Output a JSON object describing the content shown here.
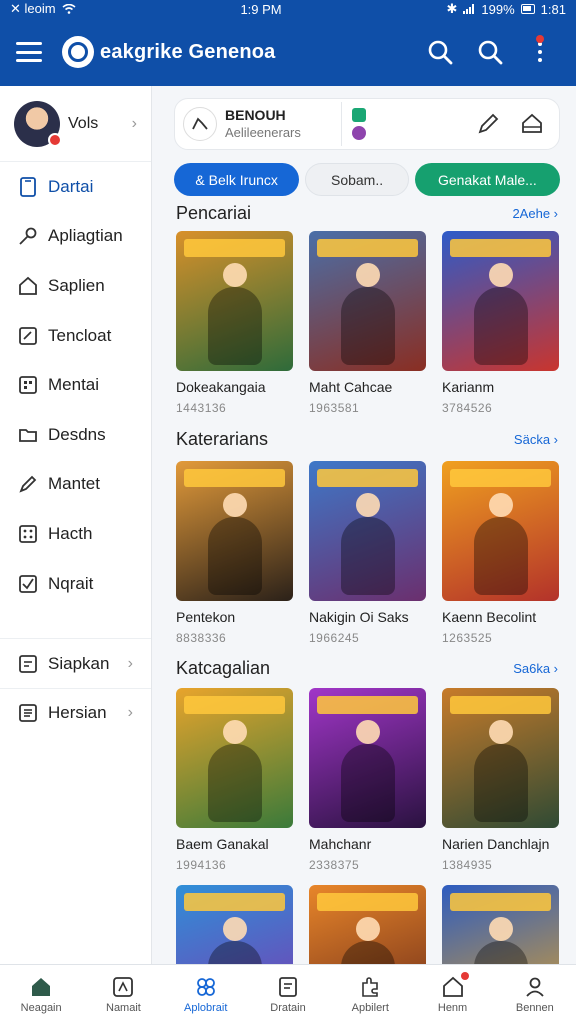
{
  "status_bar": {
    "carrier": "✕ leoim",
    "time": "1:9 PM",
    "battery": "199%",
    "clock2": "1:81"
  },
  "app_bar": {
    "title": "eakgrike Genenoa"
  },
  "sidebar": {
    "profile_name": "Vols",
    "items": [
      {
        "label": "Dartai",
        "icon": "phone-icon"
      },
      {
        "label": "Apliagtian",
        "icon": "key-icon"
      },
      {
        "label": "Saplien",
        "icon": "home-icon"
      },
      {
        "label": "Tencloat",
        "icon": "edit-box-icon"
      },
      {
        "label": "Mentai",
        "icon": "grid-icon"
      },
      {
        "label": "Desdns",
        "icon": "folder-icon"
      },
      {
        "label": "Mantet",
        "icon": "pen-icon"
      },
      {
        "label": "Hacth",
        "icon": "grid-small-icon"
      },
      {
        "label": "Nqrait",
        "icon": "check-icon"
      }
    ],
    "extra_items": [
      {
        "label": "Siapkan",
        "icon": "note-icon"
      },
      {
        "label": "Hersian",
        "icon": "list-icon"
      }
    ]
  },
  "top_card": {
    "title": "BENOUH",
    "subtitle": "Aelileenerars"
  },
  "chips": [
    "& Belk Iruncx",
    "Sobam..",
    "Genakat Male..."
  ],
  "sections": [
    {
      "title": "Pencariai",
      "more": "2Aehe ›",
      "games": [
        {
          "name": "Dokeakangaia",
          "stat": "1443136",
          "c1": "#d8902a",
          "c2": "#2e6b3a"
        },
        {
          "name": "Maht Cahcae",
          "stat": "1963581",
          "c1": "#4a6fa8",
          "c2": "#8a2e22"
        },
        {
          "name": "Karianm",
          "stat": "3784526",
          "c1": "#2d5bc9",
          "c2": "#c9352e"
        }
      ]
    },
    {
      "title": "Katerarians",
      "more": "Säcka ›",
      "games": [
        {
          "name": "Pentekon",
          "stat": "8838336",
          "c1": "#e29a3a",
          "c2": "#2b2119"
        },
        {
          "name": "Nakigin Oi Saks",
          "stat": "1966245",
          "c1": "#3e78c8",
          "c2": "#6b2f6e"
        },
        {
          "name": "Kaenn Becolint",
          "stat": "1263525",
          "c1": "#f0a020",
          "c2": "#b3322a"
        }
      ]
    },
    {
      "title": "Katcagalian",
      "more": "Sa6ka ›",
      "games": [
        {
          "name": "Baem Ganakal",
          "stat": "1994136",
          "c1": "#e8a42c",
          "c2": "#3a7a3a"
        },
        {
          "name": "Mahchanr",
          "stat": "2338375",
          "c1": "#a136c8",
          "c2": "#2a1240"
        },
        {
          "name": "Narien Danchlajn",
          "stat": "1384935",
          "c1": "#c77b2a",
          "c2": "#2f4a34"
        }
      ]
    },
    {
      "title": "",
      "more": "",
      "games": [
        {
          "name": "",
          "stat": "",
          "c1": "#2f8fd8",
          "c2": "#7a3ab0"
        },
        {
          "name": "",
          "stat": "",
          "c1": "#e8862a",
          "c2": "#6a2a18"
        },
        {
          "name": "",
          "stat": "",
          "c1": "#2d5cc0",
          "c2": "#d8a030"
        }
      ]
    }
  ],
  "bottom_nav": [
    {
      "label": "Neagain",
      "icon": "home-icon"
    },
    {
      "label": "Namait",
      "icon": "compass-icon"
    },
    {
      "label": "Aplobrait",
      "icon": "apps-icon"
    },
    {
      "label": "Dratain",
      "icon": "document-icon"
    },
    {
      "label": "Apbilert",
      "icon": "puzzle-icon"
    },
    {
      "label": "Henm",
      "icon": "house-alert-icon"
    },
    {
      "label": "Bennen",
      "icon": "profile-icon"
    }
  ],
  "colors": {
    "primary": "#0f4fa8",
    "accent_blue": "#1667d6",
    "accent_green": "#16a06f",
    "badge_red": "#e53935"
  }
}
